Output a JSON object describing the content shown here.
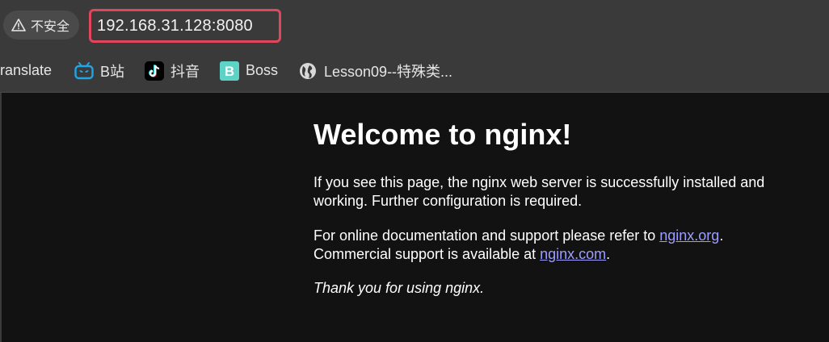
{
  "address_bar": {
    "security_label": "不安全",
    "url": "192.168.31.128:8080"
  },
  "bookmarks": [
    {
      "label": "ranslate",
      "icon": "translate-icon"
    },
    {
      "label": "B站",
      "icon": "bilibili-icon"
    },
    {
      "label": "抖音",
      "icon": "douyin-icon"
    },
    {
      "label": "Boss",
      "icon": "boss-icon"
    },
    {
      "label": "Lesson09--特殊类...",
      "icon": "globe-icon"
    }
  ],
  "page": {
    "heading": "Welcome to nginx!",
    "para1": "If you see this page, the nginx web server is successfully installed and working. Further configuration is required.",
    "para2_prefix": "For online documentation and support please refer to ",
    "link1": "nginx.org",
    "para2_mid": ".",
    "para2_line2_prefix": "Commercial support is available at ",
    "link2": "nginx.com",
    "para2_suffix": ".",
    "para3": "Thank you for using nginx."
  },
  "colors": {
    "page_background": "#121212",
    "toolbar_background": "#3a3a3a",
    "url_highlight_border": "#e0475d",
    "link_color": "#9e9eff"
  }
}
